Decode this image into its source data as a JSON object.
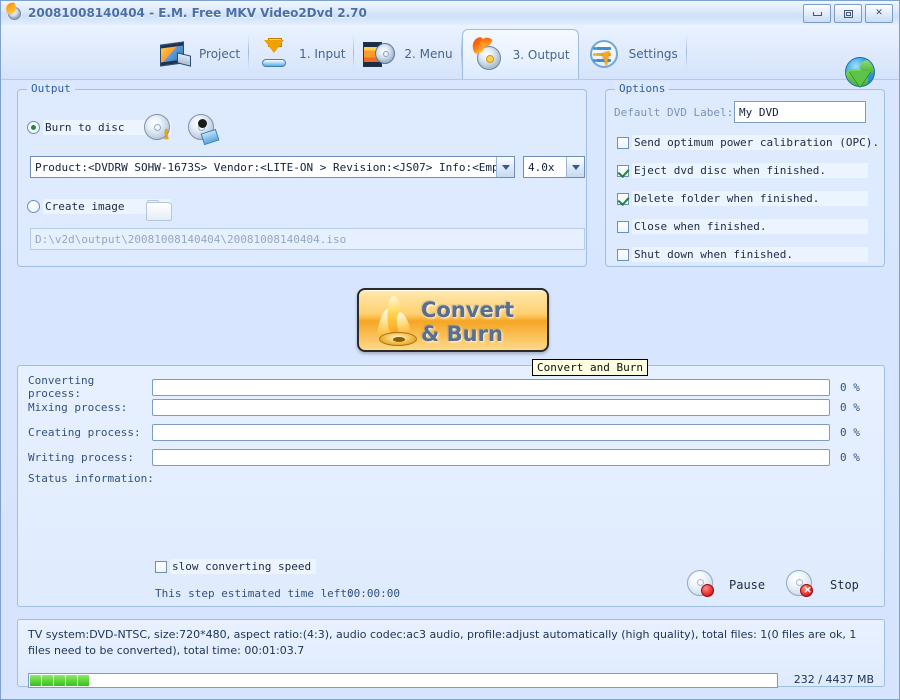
{
  "window": {
    "title": "20081008140404 - E.M. Free MKV Video2Dvd 2.70",
    "minimize_label": "Minimize",
    "maximize_label": "Maximize",
    "close_label": "Close"
  },
  "toolbar": {
    "items": [
      {
        "label": "Project",
        "icon": "film-strip-icon",
        "active": false
      },
      {
        "label": "1. Input",
        "icon": "down-arrow-icon",
        "active": false
      },
      {
        "label": "2. Menu",
        "icon": "film-disc-icon",
        "active": false
      },
      {
        "label": "3. Output",
        "icon": "burning-disc-icon",
        "active": true
      },
      {
        "label": "Settings",
        "icon": "settings-list-cursor-icon",
        "active": false
      }
    ],
    "update_icon": "globe-download-icon"
  },
  "output_group": {
    "title": "Output",
    "burn_to_disc_label": "Burn to disc",
    "burn_to_disc_selected": true,
    "disc_info_icon": "disc-info-icon",
    "disc_erase_icon": "disc-erase-icon",
    "drive_value": "Product:<DVDRW SOHW-1673S> Vendor:<LITE-ON > Revision:<JS07> Info:<Empty> S",
    "speed_value": "4.0x",
    "create_image_label": "Create image",
    "create_image_selected": false,
    "browse_icon": "folder-icon",
    "image_path": "D:\\v2d\\output\\20081008140404\\20081008140404.iso"
  },
  "options_group": {
    "title": "Options",
    "dvd_label_caption": "Default DVD Label:",
    "dvd_label_value": "My DVD",
    "checkboxes": [
      {
        "label": "Send optimum power calibration (OPC).",
        "checked": false
      },
      {
        "label": "Eject dvd disc when finished.",
        "checked": true
      },
      {
        "label": "Delete folder when finished.",
        "checked": true
      },
      {
        "label": "Close when finished.",
        "checked": false
      },
      {
        "label": "Shut down when finished.",
        "checked": false
      }
    ]
  },
  "convert_button": {
    "line1": "Convert",
    "line2": "& Burn",
    "tooltip": "Convert and Burn"
  },
  "progress": {
    "rows": [
      {
        "label": "Converting process:",
        "percent_text": "0 %",
        "value": 0
      },
      {
        "label": "Mixing process:",
        "percent_text": "0 %",
        "value": 0
      },
      {
        "label": "Creating process:",
        "percent_text": "0 %",
        "value": 0
      },
      {
        "label": "Writing process:",
        "percent_text": "0 %",
        "value": 0
      }
    ],
    "status_label": "Status information:",
    "slow_speed_label": "slow converting speed",
    "slow_speed_checked": false,
    "eta_label": "This step estimated time left:",
    "eta_value": "00:00:00",
    "pause_label": "Pause",
    "stop_label": "Stop",
    "pause_icon": "disc-pause-icon",
    "stop_icon": "disc-stop-icon"
  },
  "status_bar": {
    "info": "TV system:DVD-NTSC, size:720*480, aspect ratio:(4:3), audio codec:ac3 audio, profile:adjust automatically (high quality), total files: 1(0 files are ok, 1 files need to be converted), total time: 00:01:03.7",
    "size_text": "232 / 4437 MB",
    "size_used_mb": 232,
    "size_total_mb": 4437
  },
  "colors": {
    "background": "#d6e4fd",
    "accent_blue": "#2f5fa0",
    "progress_green": "#36c21a",
    "button_orange": "#f5a623"
  }
}
